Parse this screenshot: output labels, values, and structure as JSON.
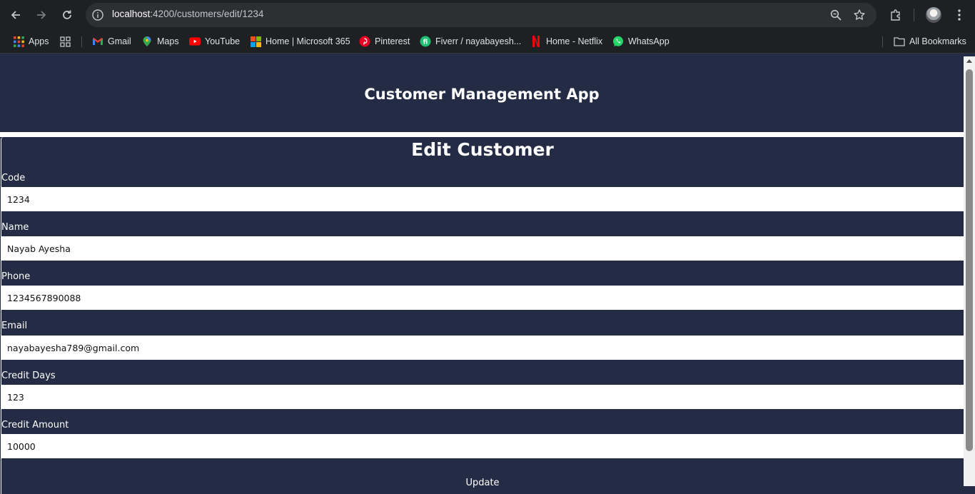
{
  "browser": {
    "url_host": "localhost",
    "url_path": ":4200/customers/edit/1234"
  },
  "bookmarks": {
    "items": [
      {
        "label": "Apps",
        "icon": "apps-grid-icon"
      },
      {
        "label": "",
        "icon": "app-launcher-icon"
      },
      {
        "label": "Gmail",
        "icon": "gmail-icon"
      },
      {
        "label": "Maps",
        "icon": "maps-icon"
      },
      {
        "label": "YouTube",
        "icon": "youtube-icon"
      },
      {
        "label": "Home | Microsoft 365",
        "icon": "microsoft-icon"
      },
      {
        "label": "Pinterest",
        "icon": "pinterest-icon"
      },
      {
        "label": "Fiverr / nayabayesh...",
        "icon": "fiverr-icon"
      },
      {
        "label": "Home - Netflix",
        "icon": "netflix-icon"
      },
      {
        "label": "WhatsApp",
        "icon": "whatsapp-icon"
      }
    ],
    "all_bookmarks": "All Bookmarks"
  },
  "app": {
    "title": "Customer Management App"
  },
  "form": {
    "title": "Edit Customer",
    "fields": [
      {
        "label": "Code",
        "value": "1234"
      },
      {
        "label": "Name",
        "value": "Nayab Ayesha"
      },
      {
        "label": "Phone",
        "value": "1234567890088"
      },
      {
        "label": "Email",
        "value": "nayabayesha789@gmail.com"
      },
      {
        "label": "Credit Days",
        "value": "123"
      },
      {
        "label": "Credit Amount",
        "value": "10000"
      }
    ],
    "submit_label": "Update"
  },
  "colors": {
    "page_bg": "#242b45",
    "chrome_bg": "#1f2023",
    "omnibox_bg": "#2e2f33"
  }
}
